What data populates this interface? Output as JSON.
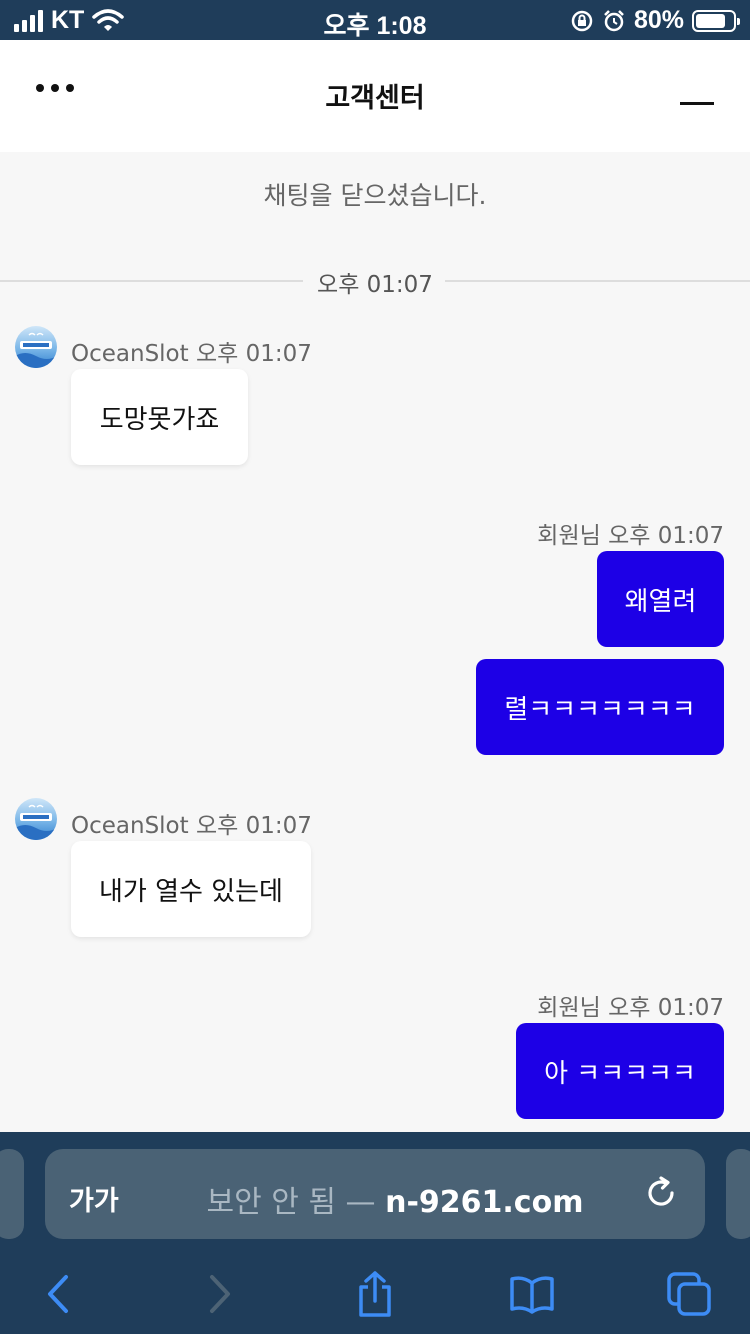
{
  "status_bar": {
    "carrier": "KT",
    "time": "오후 1:08",
    "battery_percent": "80%",
    "battery_level": 0.8
  },
  "header": {
    "title": "고객센터"
  },
  "chat": {
    "closed_notice": "채팅을 닫으셨습니다.",
    "divider_time": "오후 01:07",
    "messages": [
      {
        "sender": "OceanSlot",
        "time": "오후 01:07",
        "meta": "OceanSlot 오후 01:07",
        "direction": "in",
        "texts": [
          "도망못가죠"
        ]
      },
      {
        "sender": "회원님",
        "time": "오후 01:07",
        "meta": "회원님 오후 01:07",
        "direction": "out",
        "texts": [
          "왜열려",
          "렬ㅋㅋㅋㅋㅋㅋㅋ"
        ]
      },
      {
        "sender": "OceanSlot",
        "time": "오후 01:07",
        "meta": "OceanSlot 오후 01:07",
        "direction": "in",
        "texts": [
          "내가 열수 있는데"
        ]
      },
      {
        "sender": "회원님",
        "time": "오후 01:07",
        "meta": "회원님 오후 01:07",
        "direction": "out",
        "texts": [
          "아 ㅋㅋㅋㅋㅋ"
        ]
      }
    ],
    "colors": {
      "outgoing_bubble": "#1d00e6",
      "incoming_bubble": "#ffffff",
      "background": "#f7f7f7"
    }
  },
  "browser": {
    "text_size_button": "가가",
    "insecure_label": "보안 안 됨 —",
    "domain": "n-9261.com",
    "bar_color": "#1f3d5a",
    "icons": [
      "back-icon",
      "forward-icon",
      "share-icon",
      "bookmarks-icon",
      "tabs-icon",
      "reload-icon"
    ]
  }
}
